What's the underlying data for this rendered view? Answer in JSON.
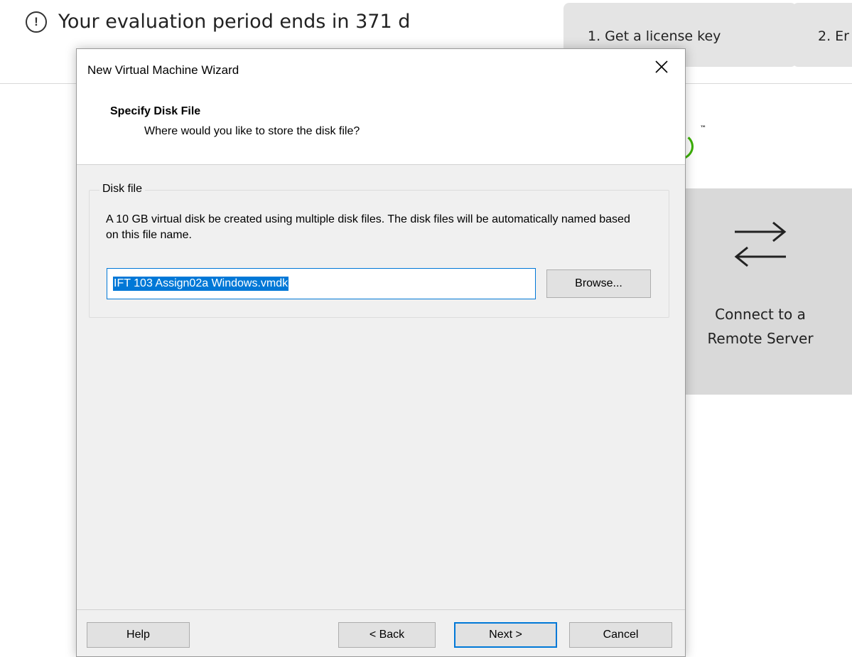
{
  "background_app": {
    "eval_icon_glyph": "!",
    "eval_message": "Your evaluation period ends in 371 d",
    "top_buttons": [
      "1. Get a license key",
      "2. Er"
    ],
    "remote_server_label": "Connect to a\nRemote Server",
    "trademark": "™",
    "accent_color": "#3bb000"
  },
  "dialog": {
    "title": "New Virtual Machine Wizard",
    "close_icon": "close-icon",
    "heading": "Specify Disk File",
    "subheading": "Where would you like to store the disk file?",
    "group_label": "Disk file",
    "description": "A 10 GB virtual disk be created using multiple disk files. The disk files will be automatically named based on this file name.",
    "file_name_value": "IFT 103 Assign02a Windows.vmdk",
    "browse_label": "Browse...",
    "buttons": {
      "help": "Help",
      "back": "< Back",
      "next": "Next >",
      "cancel": "Cancel"
    },
    "focus_color": "#0078d7"
  }
}
